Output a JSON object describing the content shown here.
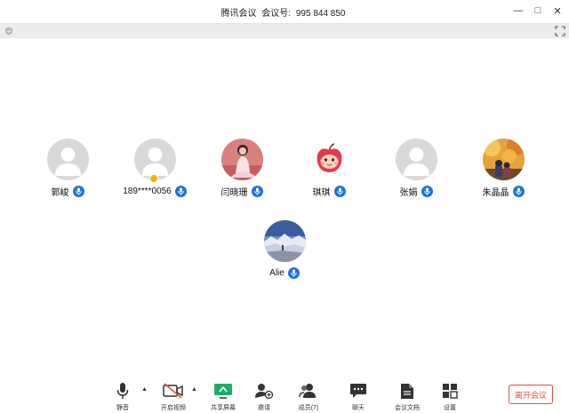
{
  "window": {
    "app_name": "腾讯会议",
    "meeting_label": "会议号:",
    "meeting_id": "995 844 850",
    "minimize": "—",
    "maximize": "□",
    "close": "✕"
  },
  "participants": [
    {
      "name": "郭峻",
      "avatar": "default"
    },
    {
      "name": "189****0056",
      "avatar": "default",
      "host_badge": true
    },
    {
      "name": "闫晓珊",
      "avatar": "photo-woman-pink"
    },
    {
      "name": "琪琪",
      "avatar": "cartoon-apple"
    },
    {
      "name": "张娟",
      "avatar": "default"
    },
    {
      "name": "朱晶晶",
      "avatar": "photo-autumn"
    },
    {
      "name": "Alie",
      "avatar": "photo-snow-landscape"
    }
  ],
  "toolbar": {
    "mute_label": "静音",
    "video_label": "开启视频",
    "share_label": "共享屏幕",
    "invite_label": "邀请",
    "members_label": "成员(7)",
    "chat_label": "聊天",
    "docs_label": "会议文档",
    "settings_label": "设置",
    "leave_label": "离开会议"
  },
  "colors": {
    "accent_blue": "#1a73e8",
    "leave_red": "#e8503a",
    "share_green": "#1aad6b"
  }
}
